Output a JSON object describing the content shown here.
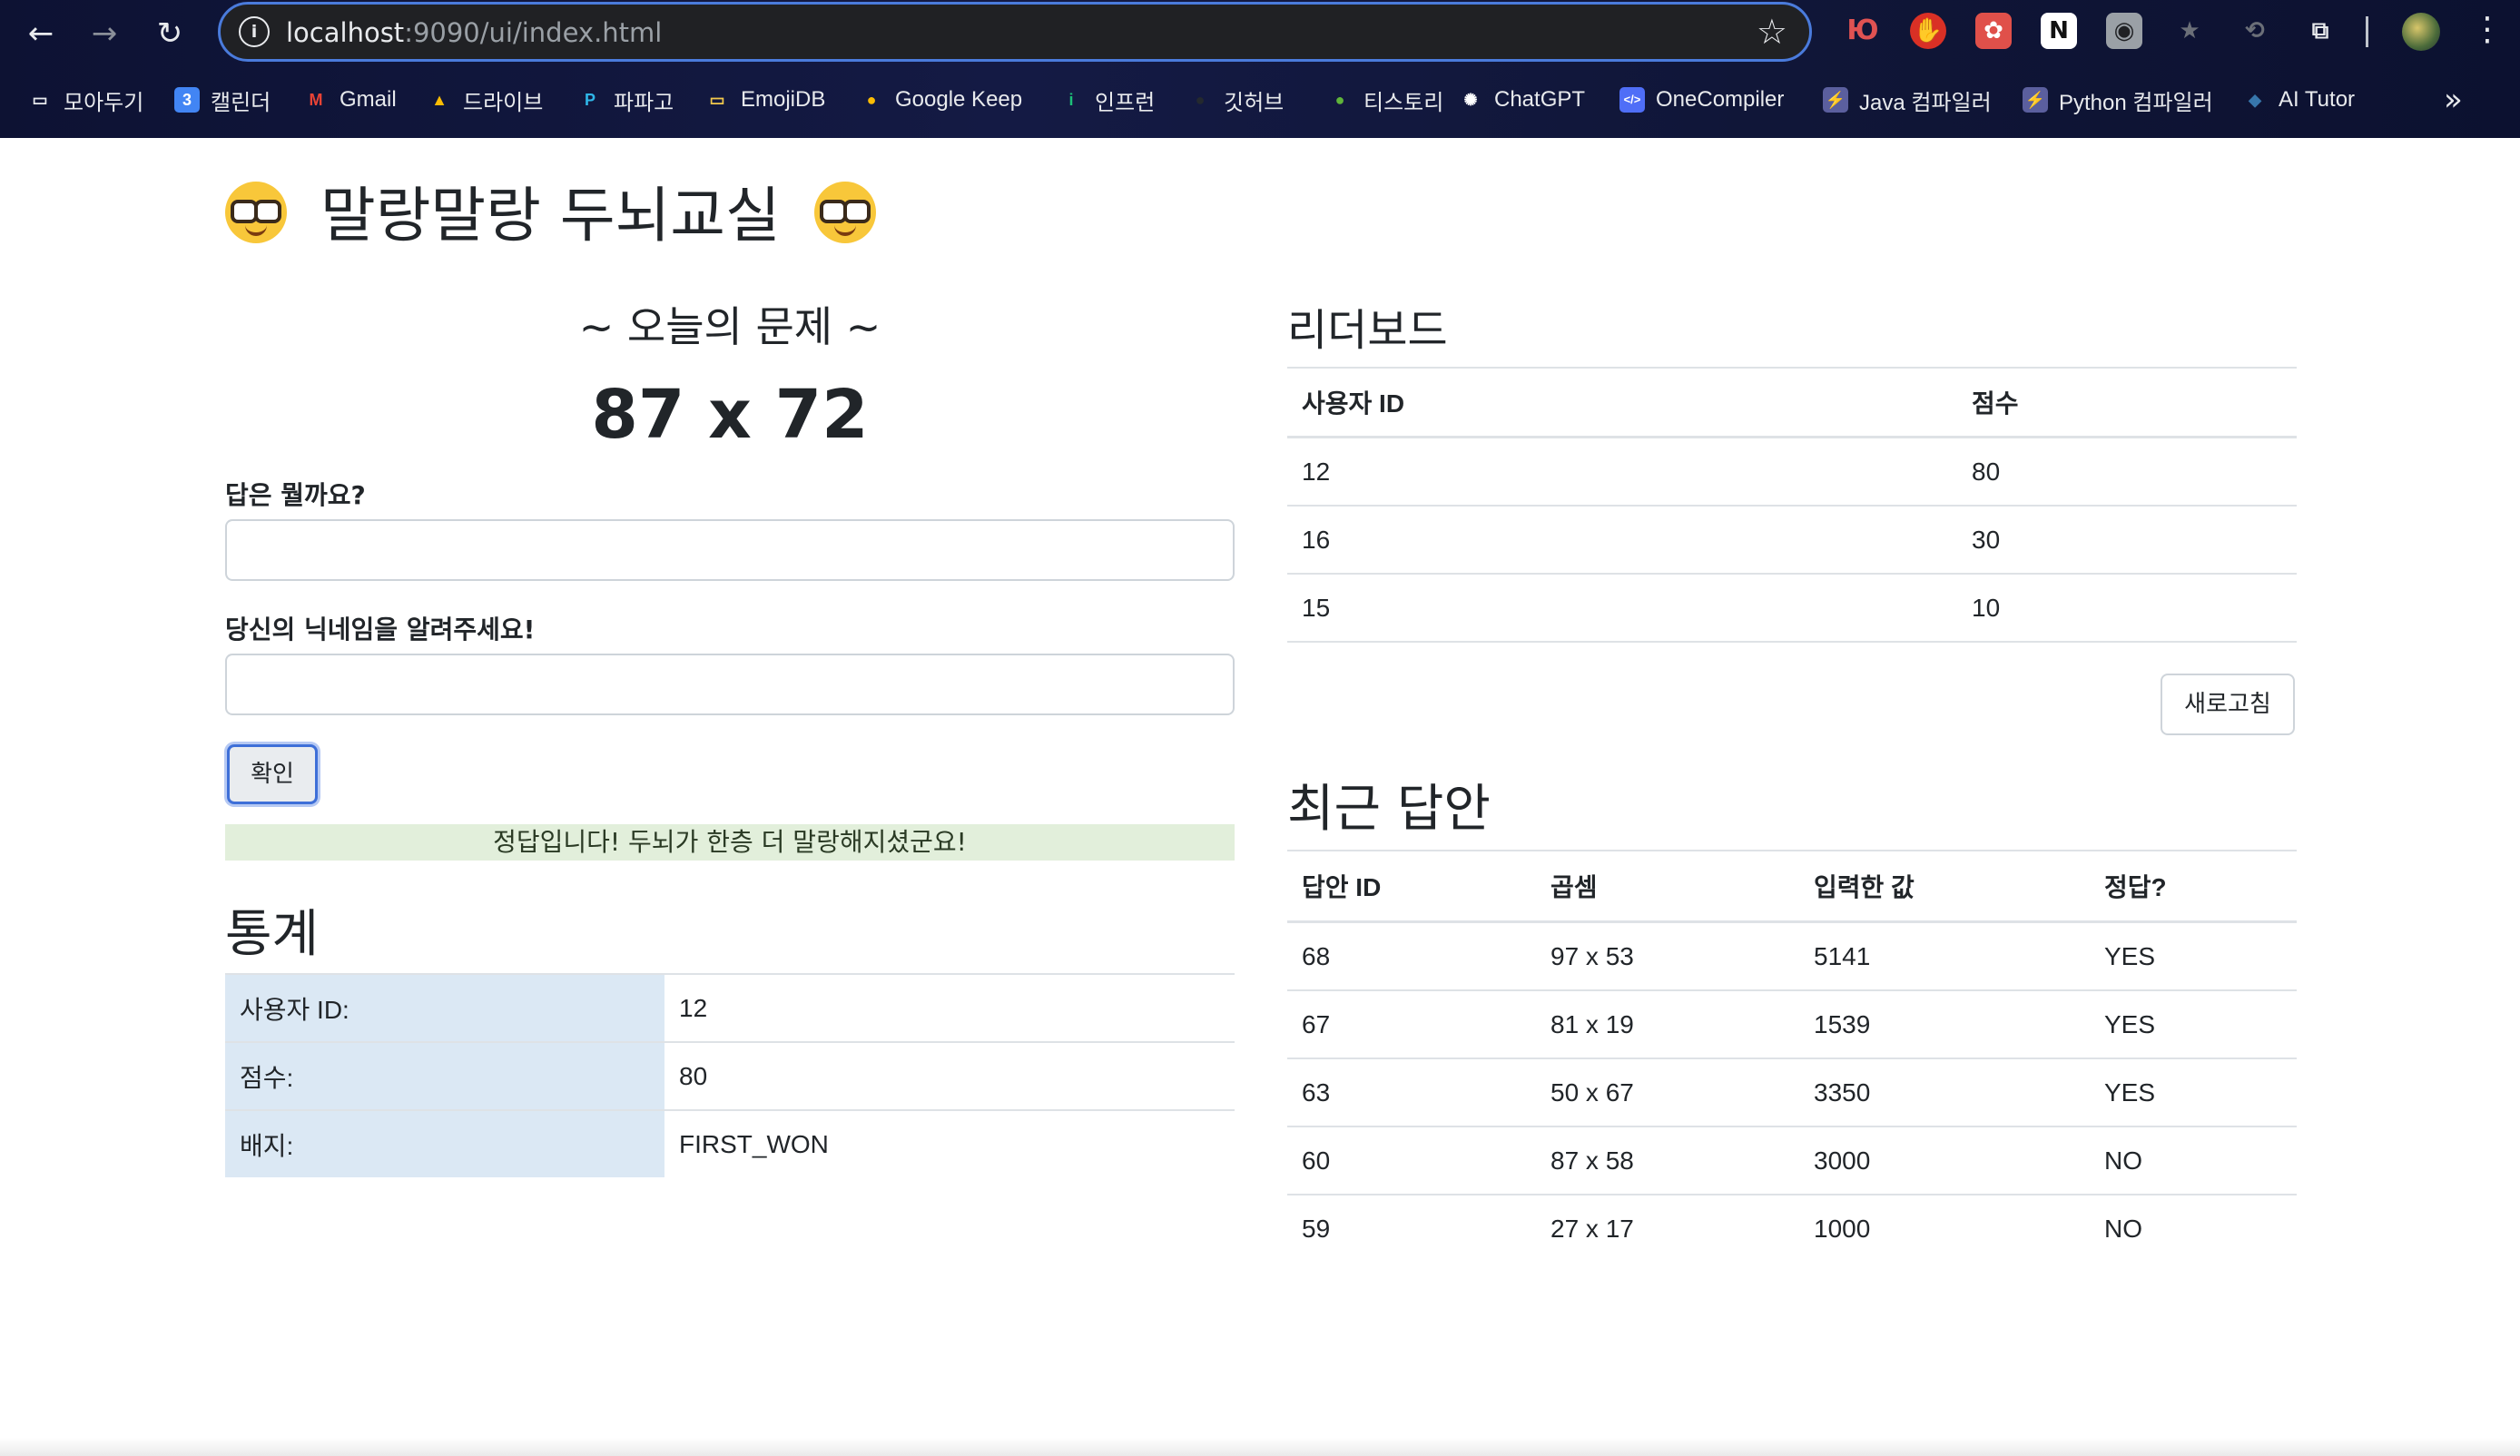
{
  "browser": {
    "url_host": "localhost",
    "url_rest": ":9090/ui/index.html",
    "bookmarks": [
      {
        "label": "모아두기",
        "icon": "folder-icon",
        "color": "#e8eaed"
      },
      {
        "label": "캘린더",
        "icon": "calendar-icon",
        "color": "#4285f4"
      },
      {
        "label": "Gmail",
        "icon": "gmail-icon",
        "color": "#ea4335"
      },
      {
        "label": "드라이브",
        "icon": "drive-icon",
        "color": "#fbbc04"
      },
      {
        "label": "파파고",
        "icon": "papago-icon",
        "color": "#2fb6e8"
      },
      {
        "label": "EmojiDB",
        "icon": "folder-icon",
        "color": "#f2c94c"
      },
      {
        "label": "Google Keep",
        "icon": "keep-icon",
        "color": "#fbbc04"
      },
      {
        "label": "인프런",
        "icon": "inflearn-icon",
        "color": "#1dc078"
      },
      {
        "label": "깃허브",
        "icon": "github-icon",
        "color": "#24292e"
      },
      {
        "label": "티스토리",
        "icon": "frog-icon",
        "color": "#5fb53a"
      },
      {
        "label": "ChatGPT",
        "icon": "chatgpt-icon",
        "color": "#ffffff"
      },
      {
        "label": "OneCompiler",
        "icon": "code-icon",
        "color": "#4f6ef7"
      },
      {
        "label": "Java 컴파일러",
        "icon": "bolt-icon",
        "color": "#5b5f9e"
      },
      {
        "label": "Python 컴파일러",
        "icon": "bolt-icon",
        "color": "#5b5f9e"
      },
      {
        "label": "AI Tutor",
        "icon": "python-icon",
        "color": "#3776ab"
      }
    ]
  },
  "page": {
    "title": "말랑말랑 두뇌교실",
    "problem_heading": "~ 오늘의 문제 ~",
    "problem": "87 x 72",
    "answer_label": "답은 뭘까요?",
    "answer_value": "",
    "nickname_label": "당신의 닉네임을 알려주세요!",
    "nickname_value": "",
    "confirm_label": "확인",
    "result_message": "정답입니다! 두뇌가 한층 더 말랑해지셨군요!",
    "stats_heading": "통계",
    "stats": [
      {
        "key": "사용자 ID:",
        "value": "12"
      },
      {
        "key": "점수:",
        "value": "80"
      },
      {
        "key": "배지:",
        "value": "FIRST_WON"
      }
    ],
    "leaderboard_heading": "리더보드",
    "leaderboard_columns": [
      "사용자 ID",
      "점수"
    ],
    "leaderboard": [
      {
        "user_id": "12",
        "score": "80"
      },
      {
        "user_id": "16",
        "score": "30"
      },
      {
        "user_id": "15",
        "score": "10"
      }
    ],
    "refresh_label": "새로고침",
    "recent_heading": "최근 답안",
    "recent_columns": [
      "답안 ID",
      "곱셈",
      "입력한 값",
      "정답?"
    ],
    "recent": [
      {
        "id": "68",
        "mult": "97 x 53",
        "input": "5141",
        "correct": "YES"
      },
      {
        "id": "67",
        "mult": "81 x 19",
        "input": "1539",
        "correct": "YES"
      },
      {
        "id": "63",
        "mult": "50 x 67",
        "input": "3350",
        "correct": "YES"
      },
      {
        "id": "60",
        "mult": "87 x 58",
        "input": "3000",
        "correct": "NO"
      },
      {
        "id": "59",
        "mult": "27 x 17",
        "input": "1000",
        "correct": "NO"
      }
    ]
  }
}
